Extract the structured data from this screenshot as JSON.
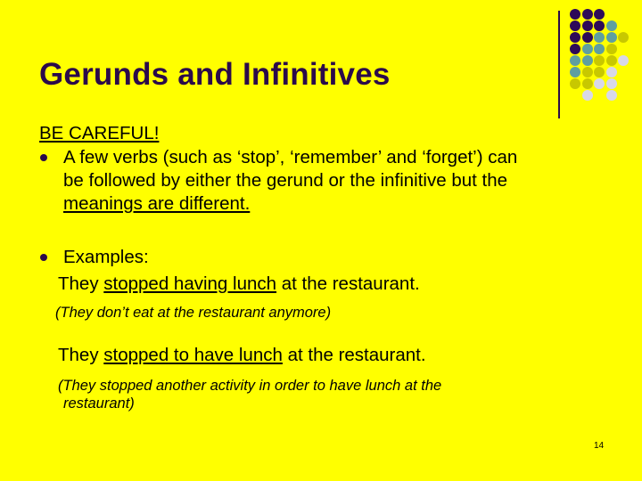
{
  "slide": {
    "title": "Gerunds and Infinitives",
    "heading": "BE CAREFUL!",
    "bullet1": {
      "line1": "A few verbs (such as ‘stop’, ‘remember’ and ‘forget’) can",
      "line2": "be followed by either the gerund or the infinitive but the",
      "line3": "meanings are different."
    },
    "bullet2": {
      "label": "Examples:",
      "example1": {
        "pre": "They ",
        "underlined": "stopped having lunch",
        "post": " at the restaurant."
      },
      "note1": "(They don’t eat at the restaurant anymore)",
      "example2": {
        "pre": "They ",
        "underlined": "stopped to have lunch",
        "post": " at the restaurant."
      },
      "note2_line1": "(They stopped another activity in order to have lunch at the",
      "note2_line2": "restaurant)"
    },
    "page_number": "14"
  },
  "decoration": {
    "colors": {
      "P": "#2e0a58",
      "T": "#5f9fa0",
      "O": "#c8c800",
      "L": "#d8d8e8",
      "background": "#ffff00"
    },
    "dot_grid": [
      "PPP..",
      "PPPT.",
      "PPTTO",
      "PTTO.",
      "TTOOL",
      "TOOL.",
      "OOLL.",
      ".L.L."
    ]
  }
}
